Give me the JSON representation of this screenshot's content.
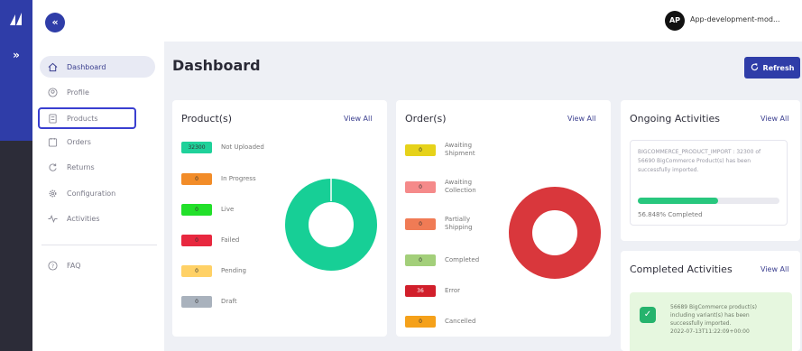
{
  "rail": {
    "expand_glyph": "»"
  },
  "sidebar": {
    "collapse_glyph": "«",
    "items": [
      {
        "label": "Dashboard",
        "icon": "home-icon"
      },
      {
        "label": "Profile",
        "icon": "profile-icon"
      },
      {
        "label": "Products",
        "icon": "products-icon"
      },
      {
        "label": "Orders",
        "icon": "orders-icon"
      },
      {
        "label": "Returns",
        "icon": "returns-icon"
      },
      {
        "label": "Configuration",
        "icon": "gear-icon"
      },
      {
        "label": "Activities",
        "icon": "activity-icon"
      },
      {
        "label": "FAQ",
        "icon": "help-icon"
      }
    ]
  },
  "header": {
    "avatar_initials": "AP",
    "account_name": "App-development-mod..."
  },
  "page": {
    "title": "Dashboard",
    "refresh_label": "Refresh"
  },
  "products_card": {
    "title": "Product(s)",
    "view_all": "View All",
    "statuses": [
      {
        "value": "32300",
        "label": "Not Uploaded",
        "color": "#1fd19a"
      },
      {
        "value": "0",
        "label": "In Progress",
        "color": "#f28c28"
      },
      {
        "value": "0",
        "label": "Live",
        "color": "#22e02a"
      },
      {
        "value": "0",
        "label": "Failed",
        "color": "#e8283f"
      },
      {
        "value": "0",
        "label": "Pending",
        "color": "#ffd166"
      },
      {
        "value": "0",
        "label": "Draft",
        "color": "#a9b2bd"
      }
    ],
    "donut_color": "#17cf96"
  },
  "orders_card": {
    "title": "Order(s)",
    "view_all": "View All",
    "statuses": [
      {
        "value": "0",
        "label": "Awaiting Shipment",
        "color": "#e6d21a"
      },
      {
        "value": "0",
        "label": "Awaiting Collection",
        "color": "#f58a8a"
      },
      {
        "value": "0",
        "label": "Partially Shipping",
        "color": "#f07b55"
      },
      {
        "value": "0",
        "label": "Completed",
        "color": "#a3cf7a"
      },
      {
        "value": "36",
        "label": "Error",
        "color": "#d11f2b"
      },
      {
        "value": "0",
        "label": "Cancelled",
        "color": "#f5a11a"
      }
    ],
    "donut_color": "#d9373c"
  },
  "ongoing": {
    "title": "Ongoing Activities",
    "view_all": "View All",
    "message": "BIGCOMMERCE_PRODUCT_IMPORT : 32300 of 56690 BigCommerce Product(s) has been successfully imported.",
    "progress_pct": 56.848,
    "progress_label": "56.848% Completed"
  },
  "completed": {
    "title": "Completed Activities",
    "view_all": "View All",
    "message": "56689 BigCommerce product(s) including variant(s) has been successfully imported.",
    "timestamp": "2022-07-13T11:22:09+00:00"
  }
}
